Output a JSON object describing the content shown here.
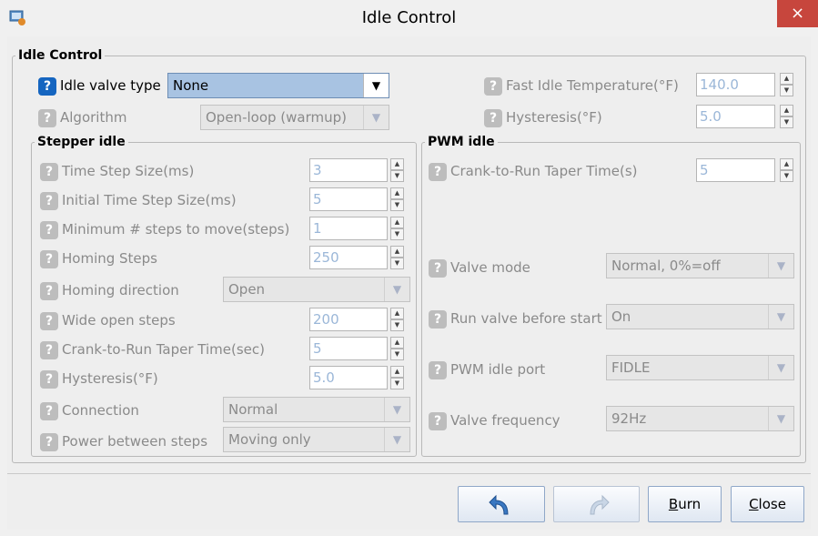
{
  "window": {
    "title": "Idle Control",
    "close_glyph": "×",
    "app_icon": "java-app-icon"
  },
  "help_glyph": "?",
  "spinner": {
    "up": "▲",
    "down": "▼"
  },
  "dropdown_glyph": "▼",
  "idle_control": {
    "legend": "Idle Control",
    "valve_type": {
      "label": "Idle valve type",
      "value": "None"
    },
    "algorithm": {
      "label": "Algorithm",
      "value": "Open-loop (warmup)"
    },
    "fast_idle_temp": {
      "label": "Fast Idle Temperature(°F)",
      "value": "140.0"
    },
    "hysteresis": {
      "label": "Hysteresis(°F)",
      "value": "5.0"
    }
  },
  "stepper_idle": {
    "legend": "Stepper idle",
    "time_step_size": {
      "label": "Time Step Size(ms)",
      "value": "3"
    },
    "initial_time_step": {
      "label": "Initial Time Step Size(ms)",
      "value": "5"
    },
    "min_steps": {
      "label": "Minimum # steps to move(steps)",
      "value": "1"
    },
    "homing_steps": {
      "label": "Homing Steps",
      "value": "250"
    },
    "homing_direction": {
      "label": "Homing direction",
      "value": "Open"
    },
    "wide_open_steps": {
      "label": "Wide open steps",
      "value": "200"
    },
    "crank_taper": {
      "label": "Crank-to-Run Taper Time(sec)",
      "value": "5"
    },
    "hysteresis": {
      "label": "Hysteresis(°F)",
      "value": "5.0"
    },
    "connection": {
      "label": "Connection",
      "value": "Normal"
    },
    "power_between_steps": {
      "label": "Power between steps",
      "value": "Moving only"
    }
  },
  "pwm_idle": {
    "legend": "PWM idle",
    "crank_taper": {
      "label": "Crank-to-Run Taper Time(s)",
      "value": "5"
    },
    "valve_mode": {
      "label": "Valve mode",
      "value": "Normal, 0%=off"
    },
    "run_before_start": {
      "label": "Run valve before start",
      "value": "On"
    },
    "pwm_port": {
      "label": "PWM idle port",
      "value": "FIDLE"
    },
    "valve_frequency": {
      "label": "Valve frequency",
      "value": "92Hz"
    }
  },
  "buttons": {
    "undo_icon": "undo-arrow-icon",
    "redo_icon": "redo-arrow-icon",
    "burn_key": "B",
    "burn_rest": "urn",
    "close_key": "C",
    "close_rest": "lose"
  }
}
